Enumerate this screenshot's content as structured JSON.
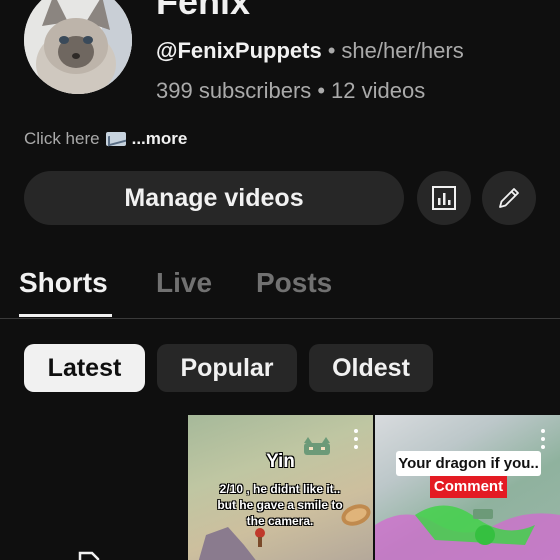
{
  "channel": {
    "name": "Fenix",
    "handle": "@FenixPuppets",
    "pronouns": "she/her/hers",
    "subscribers": "399 subscribers",
    "videos": "12 videos",
    "separator": "•",
    "about_text": "Click here",
    "about_more": "...more"
  },
  "actions": {
    "manage_label": "Manage videos"
  },
  "tabs": [
    {
      "label": "Shorts",
      "active": true
    },
    {
      "label": "Live",
      "active": false
    },
    {
      "label": "Posts",
      "active": false
    }
  ],
  "chips": [
    {
      "label": "Latest",
      "selected": true
    },
    {
      "label": "Popular",
      "selected": false
    },
    {
      "label": "Oldest",
      "selected": false
    }
  ],
  "shorts": [
    {
      "title": "",
      "caption": ""
    },
    {
      "title": "Yin",
      "caption": "2/10 , he didnt like it.. but he gave a smile to the camera."
    },
    {
      "title": "Your dragon if you..",
      "caption": "Comment"
    }
  ],
  "colors": {
    "background": "#0f0f0f",
    "surface": "#272727",
    "text_primary": "#f1f1f1",
    "text_secondary": "#aaaaaa",
    "comment_red": "#e41b23"
  },
  "icons": {
    "analytics": "bar-chart-icon",
    "edit": "pencil-icon",
    "more": "kebab-menu-icon",
    "email": "email-emoji-icon"
  }
}
